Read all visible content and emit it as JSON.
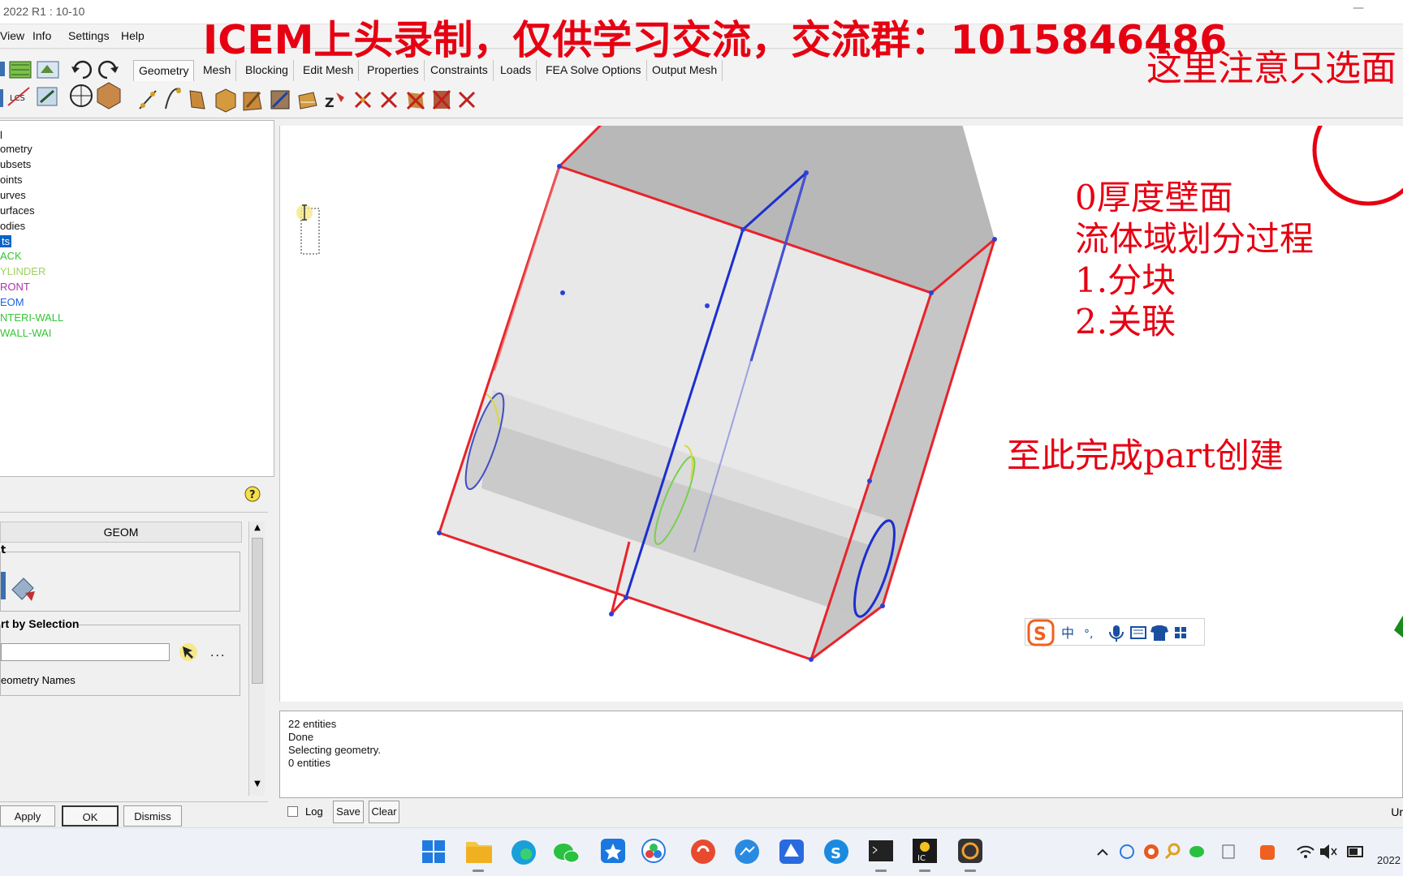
{
  "window": {
    "title": "2022 R1 : 10-10",
    "minimize_glyph": "—"
  },
  "watermark": "ICEM上头录制，仅供学习交流，交流群：1015846486",
  "menu": [
    "View",
    "Info",
    "Settings",
    "Help"
  ],
  "tabs": [
    "Geometry",
    "Mesh",
    "Blocking",
    "Edit Mesh",
    "Properties",
    "Constraints",
    "Loads",
    "FEA Solve Options",
    "Output Mesh"
  ],
  "model_tree": {
    "items": [
      {
        "label": "l",
        "color": "#111111"
      },
      {
        "label": "ometry",
        "color": "#111111"
      },
      {
        "label": "ubsets",
        "color": "#111111"
      },
      {
        "label": "oints",
        "color": "#111111"
      },
      {
        "label": "urves",
        "color": "#111111"
      },
      {
        "label": "urfaces",
        "color": "#111111"
      },
      {
        "label": "odies",
        "color": "#111111"
      },
      {
        "label": "ts",
        "color": "#ffffff",
        "selected": true
      },
      {
        "label": "ACK",
        "color": "#36c436"
      },
      {
        "label": "YLINDER",
        "color": "#a0d060"
      },
      {
        "label": "RONT",
        "color": "#b030b0"
      },
      {
        "label": "EOM",
        "color": "#2060e0"
      },
      {
        "label": "NTERI-WALL",
        "color": "#36c436"
      },
      {
        "label": "WALL-WAI",
        "color": "#36c436"
      }
    ]
  },
  "form": {
    "header": "GEOM",
    "group1_label": "t",
    "group2_label": "rt by Selection",
    "ellipsis": "...",
    "geometry_names_label": "eometry Names",
    "apply_label": "Apply",
    "ok_label": "OK",
    "dismiss_label": "Dismiss",
    "help_glyph": "?"
  },
  "messages": [
    "22 entities",
    "Done",
    "Selecting geometry.",
    "0 entities"
  ],
  "message_controls": {
    "log_label": "Log",
    "save_label": "Save",
    "clear_label": "Clear",
    "units_label": "Ur"
  },
  "annotations": {
    "top_right": "这里注意只选面",
    "steps": [
      "0厚度壁面",
      "流体域划分过程",
      "1.分块",
      "2.关联"
    ],
    "done": "至此完成part创建"
  },
  "ime_bar": {
    "items": [
      "中",
      "°,"
    ]
  },
  "taskbar": {
    "clock": "2022"
  },
  "colors": {
    "annotation": "#e60012",
    "edge_red": "#e8232a",
    "edge_blue": "#1c2fd0",
    "accent": "#0a64c8"
  }
}
